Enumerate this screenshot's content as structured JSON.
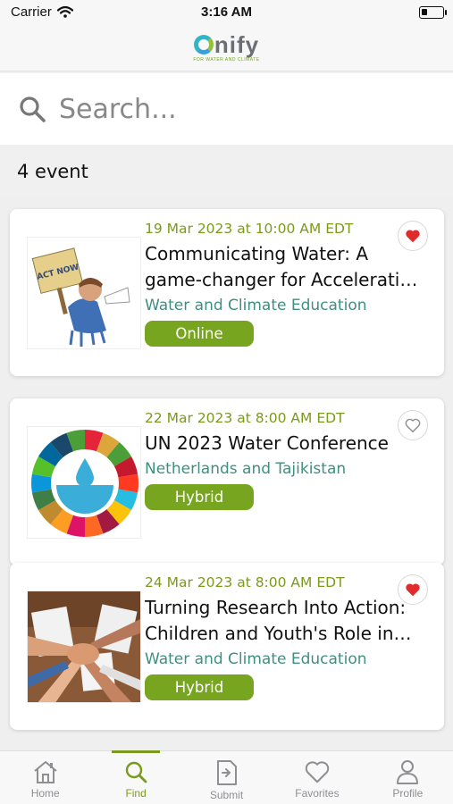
{
  "status_bar": {
    "carrier": "Carrier",
    "time": "3:16 AM"
  },
  "header": {
    "logo_text": "nify",
    "logo_tagline": "FOR WATER AND CLIMATE"
  },
  "search": {
    "placeholder": "Search..."
  },
  "results": {
    "count_label": "4 event"
  },
  "events": [
    {
      "date": "19 Mar 2023 at 10:00 AM EDT",
      "title": "Communicating Water: A game-changer for Accelerati…",
      "category": "Water and Climate Education",
      "mode": "Online",
      "favorited": true,
      "sign_text": "ACT NOW"
    },
    {
      "date": "22 Mar 2023 at 8:00 AM EDT",
      "title": "UN 2023 Water Conference",
      "category": "Netherlands and Tajikistan",
      "mode": "Hybrid",
      "favorited": false
    },
    {
      "date": "24 Mar 2023 at 8:00 AM EDT",
      "title": "Turning Research Into Action: Children and Youth's Role in…",
      "category": "Water and Climate Education",
      "mode": "Hybrid",
      "favorited": true
    }
  ],
  "tabs": [
    {
      "label": "Home",
      "icon": "home-icon"
    },
    {
      "label": "Find",
      "icon": "search-icon",
      "active": true
    },
    {
      "label": "Submit",
      "icon": "submit-icon"
    },
    {
      "label": "Favorites",
      "icon": "heart-icon"
    },
    {
      "label": "Profile",
      "icon": "person-icon"
    }
  ],
  "colors": {
    "accent": "#7a9a1c",
    "category": "#3f8f80",
    "badge": "#77a51f",
    "heart": "#e02b2b"
  }
}
